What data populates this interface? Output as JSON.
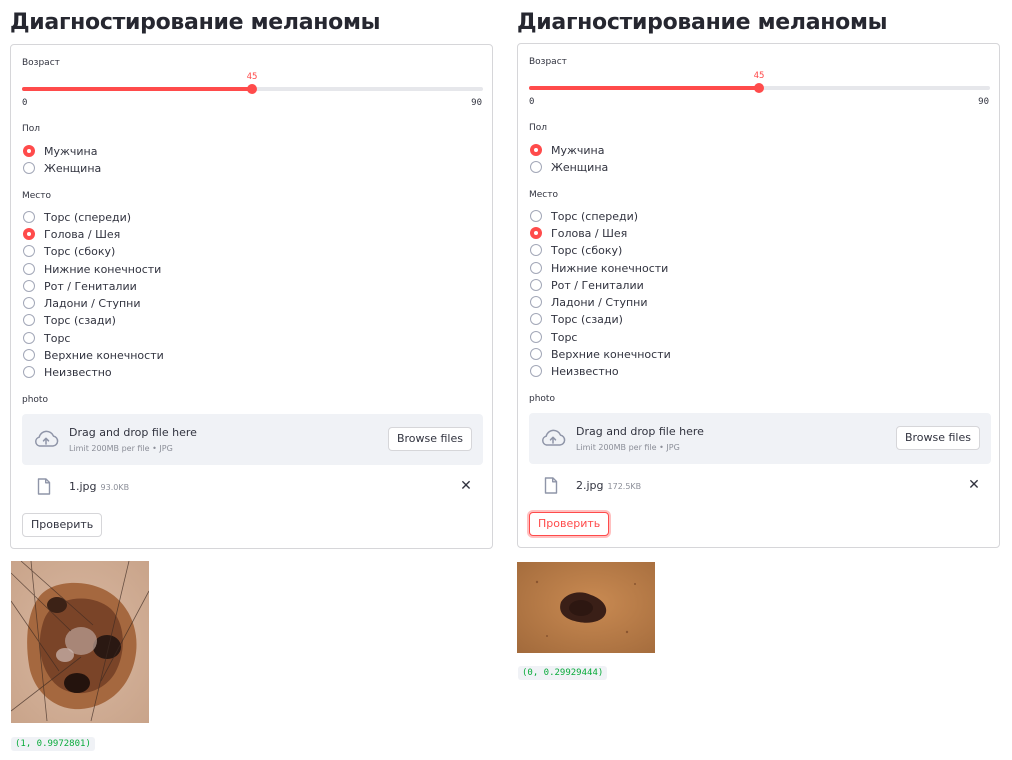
{
  "colors": {
    "accent": "#ff4b4b",
    "result_text": "#09ab3b",
    "dropzone_bg": "#f0f2f6"
  },
  "panels": [
    {
      "title": "Диагностирование меланомы",
      "age": {
        "label": "Возраст",
        "value": "45",
        "min": "0",
        "max": "90",
        "fraction": 0.5
      },
      "sex": {
        "label": "Пол",
        "options": [
          "Мужчина",
          "Женщина"
        ],
        "selected": "Мужчина"
      },
      "site": {
        "label": "Место",
        "options": [
          "Торс (спереди)",
          "Голова / Шея",
          "Торс (сбоку)",
          "Нижние конечности",
          "Рот / Гениталии",
          "Ладони / Ступни",
          "Торс (сзади)",
          "Торс",
          "Верхние конечности",
          "Неизвестно"
        ],
        "selected": "Голова / Шея"
      },
      "upload": {
        "label": "photo",
        "drop_text": "Drag and drop file here",
        "limit_text": "Limit 200MB per file • JPG",
        "browse_label": "Browse files",
        "file_name": "1.jpg",
        "file_size": "93.0KB"
      },
      "submit_label": "Проверить",
      "result": "(1, 0.9972801)"
    },
    {
      "title": "Диагностирование меланомы",
      "age": {
        "label": "Возраст",
        "value": "45",
        "min": "0",
        "max": "90",
        "fraction": 0.5
      },
      "sex": {
        "label": "Пол",
        "options": [
          "Мужчина",
          "Женщина"
        ],
        "selected": "Мужчина"
      },
      "site": {
        "label": "Место",
        "options": [
          "Торс (спереди)",
          "Голова / Шея",
          "Торс (сбоку)",
          "Нижние конечности",
          "Рот / Гениталии",
          "Ладони / Ступни",
          "Торс (сзади)",
          "Торс",
          "Верхние конечности",
          "Неизвестно"
        ],
        "selected": "Голова / Шея"
      },
      "upload": {
        "label": "photo",
        "drop_text": "Drag and drop file here",
        "limit_text": "Limit 200MB per file • JPG",
        "browse_label": "Browse files",
        "file_name": "2.jpg",
        "file_size": "172.5KB"
      },
      "submit_label": "Проверить",
      "result": "(0, 0.29929444)"
    }
  ]
}
